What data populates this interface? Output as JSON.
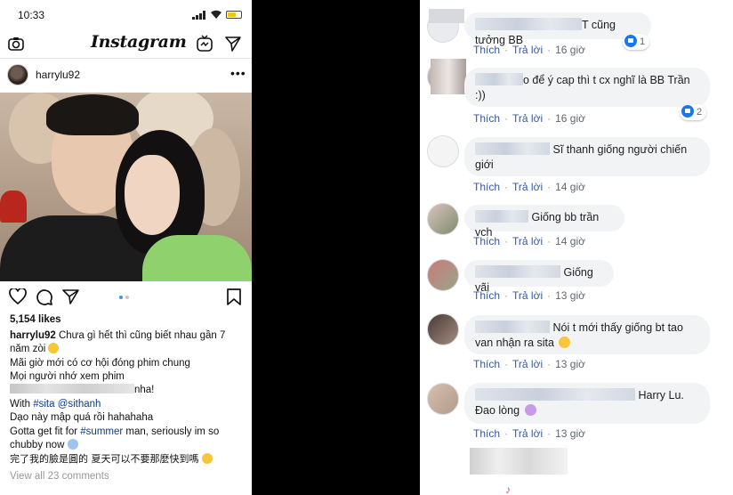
{
  "instagram": {
    "status_time": "10:33",
    "logo": "Instagram",
    "post_user": "harrylu92",
    "more_label": "•••",
    "likes": "5,154 likes",
    "caption_user": "harrylu92",
    "caption_line1": "Chưa gì hết thì cũng biết nhau gần 7",
    "caption_line2": "năm zòi",
    "line3": "Mãi giờ mới có cơ hội đóng phim chung",
    "line4": "Mọi người nhớ xem phim",
    "line5_suffix": "nha!",
    "line6_prefix": "With",
    "line6_tags": "#sita @sithanh",
    "line7": "Dạo này mập quá rồi hahahaha",
    "line8_prefix": "Gotta get fit for",
    "line8_tag": "#summer",
    "line8_suffix": "man, seriously im so",
    "line9": "chubby now",
    "line10": "完了我的臉是圓的 夏天可以不要那麼快到嗎",
    "view_comments": "View all 23 comments",
    "icons": [
      "camera-icon",
      "igtv-icon",
      "direct-icon",
      "heart-icon",
      "comment-icon",
      "share-icon",
      "bookmark-icon"
    ]
  },
  "facebook": {
    "like_label": "Thích",
    "reply_label": "Trả lời",
    "separator": "·",
    "comments": [
      {
        "text": "T cũng tưởng BB",
        "time": "16 giờ",
        "reactions": "1"
      },
      {
        "text1": "o để ý cap thì t cx nghĩ là BB Trần",
        "text2": ":))",
        "time": "16 giờ",
        "reactions": "2"
      },
      {
        "text1": "Sĩ thanh giống người chiến",
        "text2": "giới",
        "time": "14 giờ"
      },
      {
        "text": "Giống bb trần vch",
        "time": "14 giờ"
      },
      {
        "text": "Giống vãi",
        "time": "13 giờ"
      },
      {
        "text1": "Nói t mới thấy giống bt tao",
        "text2": "van nhận ra sita",
        "time": "13 giờ"
      },
      {
        "text1": "Harry Lu.",
        "text2": "Đao lòng",
        "time": "13 giờ"
      }
    ]
  }
}
